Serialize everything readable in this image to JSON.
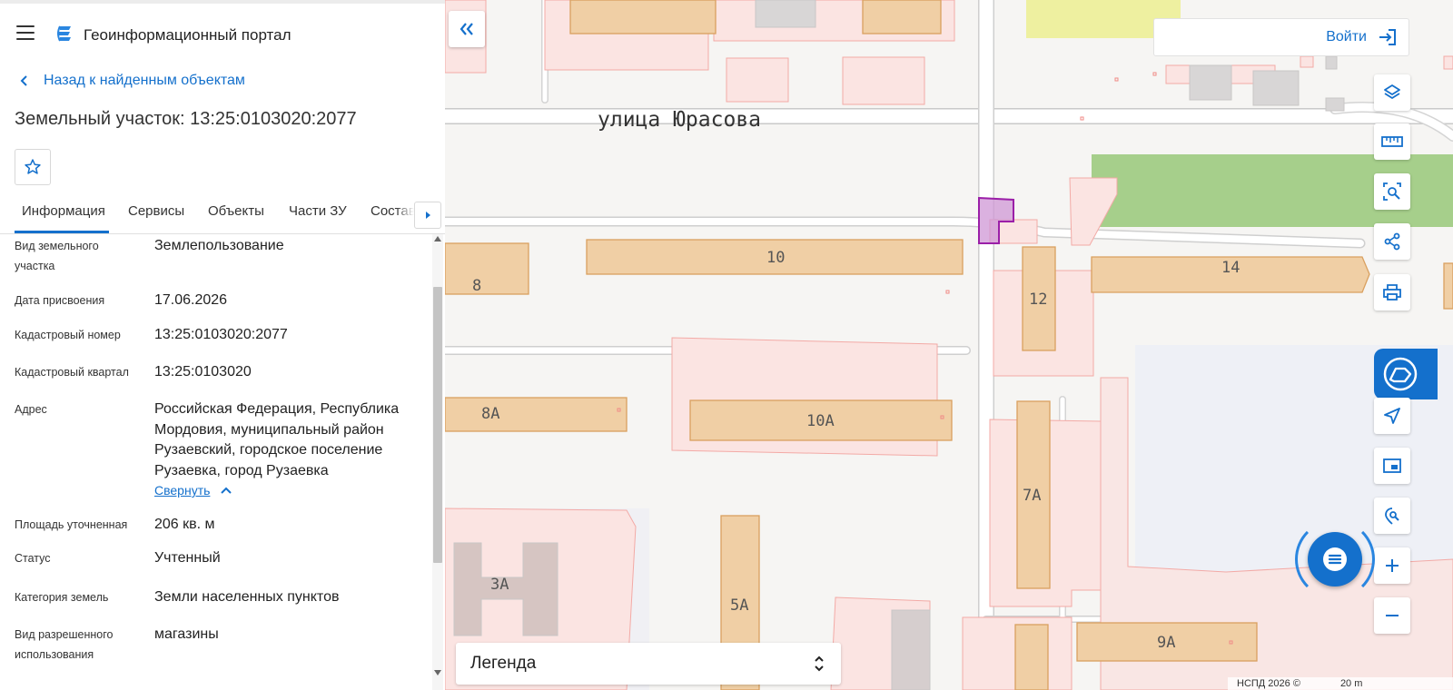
{
  "header": {
    "portal_title": "Геоинформационный портал"
  },
  "back_link": "Назад к найденным объектам",
  "parcel_title": "Земельный участок: 13:25:0103020:2077",
  "tabs": [
    {
      "label": "Информация"
    },
    {
      "label": "Сервисы"
    },
    {
      "label": "Объекты"
    },
    {
      "label": "Части ЗУ"
    },
    {
      "label": "Состав"
    }
  ],
  "info_rows": [
    {
      "label": "Вид земельного участка",
      "value": "Землепользование"
    },
    {
      "label": "Дата присвоения",
      "value": "17.06.2026"
    },
    {
      "label": "Кадастровый номер",
      "value": "13:25:0103020:2077"
    },
    {
      "label": "Кадастровый квартал",
      "value": "13:25:0103020"
    },
    {
      "label": "Адрес",
      "value": "Российская Федерация, Республика Мордовия, муниципальный район Рузаевский, городское поселение Рузаевка, город Рузаевка"
    },
    {
      "label": "Площадь уточненная",
      "value": "206 кв. м"
    },
    {
      "label": "Статус",
      "value": "Учтенный"
    },
    {
      "label": "Категория земель",
      "value": "Земли населенных пунктов"
    },
    {
      "label": "Вид разрешенного использования",
      "value": "магазины"
    }
  ],
  "collapse_link": "Свернуть",
  "map": {
    "street_name": "улица Юрасова",
    "login_label": "Войти",
    "legend_label": "Легенда",
    "attribution": "НСПД 2026 ©",
    "scale_label": "20 m",
    "building_labels": [
      "10",
      "8",
      "12",
      "14",
      "8А",
      "10А",
      "7А",
      "3А",
      "5А",
      "9А"
    ],
    "tools": [
      "layers-icon",
      "ruler-icon",
      "search-area-icon",
      "share-icon",
      "print-icon",
      "nspd-icon",
      "locate-icon",
      "minimap-icon",
      "geo-search-icon",
      "zoom-in-icon",
      "zoom-out-icon"
    ],
    "colors": {
      "accent": "#1470cc",
      "building_fill": "#f0cfa5",
      "building_stroke": "#d9a05f",
      "parcel_fill": "#fbe4e2",
      "parcel_stroke": "#f3aaa6",
      "selected_fill": "#cf97d6",
      "selected_stroke": "#9b1fa8",
      "green_area": "#a6cf8b",
      "yellow_area": "#eef0a0"
    }
  }
}
